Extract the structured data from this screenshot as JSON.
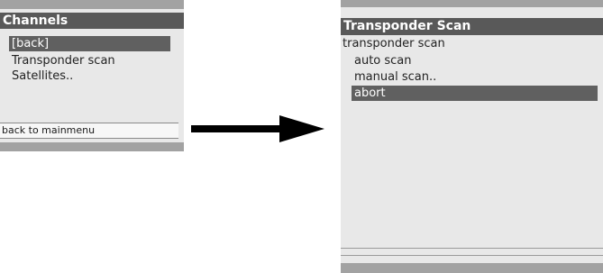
{
  "left_screen": {
    "title": "Channels",
    "items": [
      {
        "label": "[back]",
        "selected": true
      },
      {
        "label": "Transponder scan",
        "selected": false
      },
      {
        "label": "Satellites..",
        "selected": false
      }
    ],
    "footer": "back to mainmenu"
  },
  "arrow": {
    "icon": "right-arrow-icon",
    "color": "#000000"
  },
  "right_screen": {
    "title": "Transponder Scan",
    "subtitle": "transponder scan",
    "items": [
      {
        "label": "auto scan",
        "selected": false
      },
      {
        "label": "manual scan..",
        "selected": false
      },
      {
        "label": "abort",
        "selected": true
      }
    ]
  },
  "colors": {
    "screen_bg": "#e8e8e8",
    "header_bg": "#595959",
    "selected_bg": "#606060",
    "bar": "#a2a2a2"
  }
}
